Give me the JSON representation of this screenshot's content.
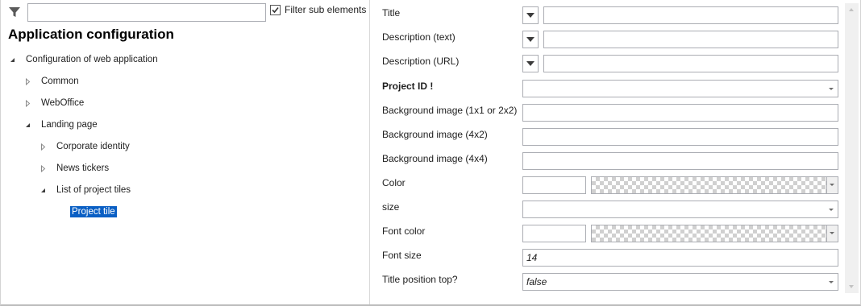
{
  "filter": {
    "icon": "filter-icon",
    "value": "",
    "checkbox_checked": true,
    "checkbox_label": "Filter sub elements"
  },
  "title": "Application configuration",
  "tree": [
    {
      "label": "Configuration of web application",
      "expanded": true,
      "level": 0
    },
    {
      "label": "Common",
      "expanded": false,
      "level": 1
    },
    {
      "label": "WebOffice",
      "expanded": false,
      "level": 1
    },
    {
      "label": "Landing page",
      "expanded": true,
      "level": 1
    },
    {
      "label": "Corporate identity",
      "expanded": false,
      "level": 2
    },
    {
      "label": "News tickers",
      "expanded": false,
      "level": 2
    },
    {
      "label": "List of project tiles",
      "expanded": true,
      "level": 2
    },
    {
      "label": "Project tile",
      "selected": true,
      "level": 3
    }
  ],
  "properties": [
    {
      "label": "Title",
      "type": "mode-text",
      "value": ""
    },
    {
      "label": "Description (text)",
      "type": "mode-text",
      "value": ""
    },
    {
      "label": "Description (URL)",
      "type": "mode-text",
      "value": ""
    },
    {
      "label": "Project ID !",
      "type": "combo",
      "value": "",
      "bold": true
    },
    {
      "label": "Background image (1x1 or 2x2)",
      "type": "text",
      "value": ""
    },
    {
      "label": "Background image (4x2)",
      "type": "text",
      "value": ""
    },
    {
      "label": "Background image (4x4)",
      "type": "text",
      "value": ""
    },
    {
      "label": "Color",
      "type": "color",
      "value": ""
    },
    {
      "label": "size",
      "type": "combo",
      "value": ""
    },
    {
      "label": "Font color",
      "type": "color",
      "value": ""
    },
    {
      "label": "Font size",
      "type": "text",
      "value": "14"
    },
    {
      "label": "Title position top?",
      "type": "combo",
      "value": "false"
    }
  ],
  "colors": {
    "selection": "#0a5fc4",
    "border": "#abadb3"
  }
}
